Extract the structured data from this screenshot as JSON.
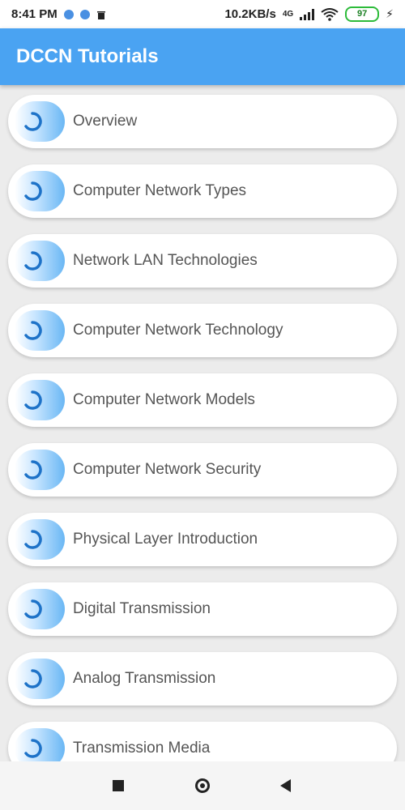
{
  "status_bar": {
    "time": "8:41 PM",
    "speed": "10.2KB/s",
    "network_label": "4G",
    "battery": "97"
  },
  "app_bar": {
    "title": "DCCN Tutorials"
  },
  "items": [
    {
      "label": "Overview",
      "icon": "loading-ring-icon"
    },
    {
      "label": "Computer Network Types",
      "icon": "loading-ring-icon"
    },
    {
      "label": "Network LAN Technologies",
      "icon": "loading-ring-icon"
    },
    {
      "label": "Computer Network Technology",
      "icon": "loading-ring-icon"
    },
    {
      "label": "Computer Network Models",
      "icon": "loading-ring-icon"
    },
    {
      "label": "Computer Network Security",
      "icon": "loading-ring-icon"
    },
    {
      "label": "Physical Layer Introduction",
      "icon": "loading-ring-icon"
    },
    {
      "label": "Digital Transmission",
      "icon": "loading-ring-icon"
    },
    {
      "label": "Analog Transmission",
      "icon": "loading-ring-icon"
    },
    {
      "label": "Transmission Media",
      "icon": "loading-ring-icon"
    }
  ],
  "colors": {
    "app_bar": "#4aa3f2",
    "icon_accent": "#6ab7f4",
    "battery": "#2dbb3a"
  }
}
